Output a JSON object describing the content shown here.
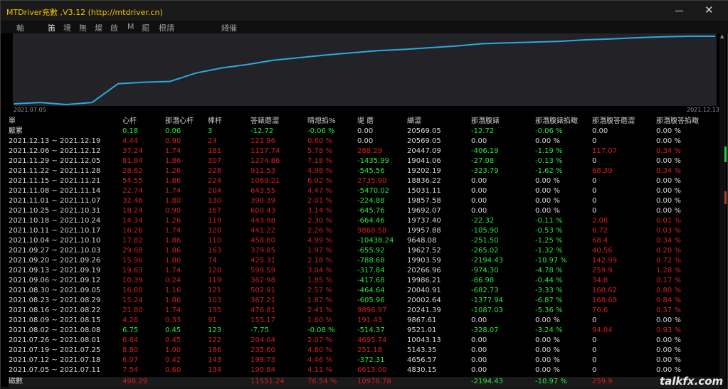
{
  "window": {
    "title": "MTDriver充數 ,V3.12 (http://mtdriver.cn)"
  },
  "tabs": [
    {
      "label": "軸"
    },
    {
      "label": "笛",
      "active": true
    },
    {
      "label": "境"
    },
    {
      "label": "無"
    },
    {
      "label": "燦"
    },
    {
      "label": "啟"
    },
    {
      "label": "M"
    },
    {
      "label": "掘"
    },
    {
      "label": "根請"
    },
    {
      "label": "綫催"
    }
  ],
  "chart_data": {
    "type": "line",
    "x_start_label": "2021.07.05",
    "x_end_label": "2021.12.13",
    "series": [
      {
        "color": "#29a9e1",
        "values": [
          4830.15,
          5143.35,
          4656.57,
          5143.35,
          9521.01,
          9867.61,
          10043.13,
          12000,
          13200,
          14000,
          15000,
          15600,
          16200,
          16700,
          17200,
          17500,
          17900,
          18300,
          18836.22,
          19032,
          19202.19,
          19400,
          19737.4,
          19957.88,
          20241.39,
          20447.09,
          20569.05,
          20569.05
        ]
      }
    ],
    "grid": false
  },
  "table": {
    "headers": [
      "單",
      "心杆",
      "那潛心杆",
      "棒杆",
      "答錶蘑澀",
      "晴熄掐%",
      "堤 蘑",
      "纈澀",
      "那潛腹錶",
      "那潛腹錶掐瞰",
      "那潛腹答蘑澀",
      "那潛腹答掐瞰"
    ],
    "rows": [
      {
        "label": "厭累",
        "cells": [
          "0.18",
          "0.06",
          "3",
          "-12.72",
          "-0.06 %",
          "0.00",
          "20569.05",
          "-12.72",
          "-0.06 %",
          "0.00",
          "0.00 %"
        ],
        "colors": [
          "green",
          "green",
          "green",
          "green",
          "green",
          "white",
          "white",
          "green",
          "green",
          "white",
          "white"
        ]
      },
      {
        "label": "2021.12.13 ~ 2021.12.19",
        "cells": [
          "4.44",
          "0.90",
          "24",
          "121.96",
          "0.60 %",
          "0.00",
          "20569.05",
          "0.00",
          "0.00 %",
          "0",
          "0.00 %"
        ],
        "colors": [
          "red",
          "red",
          "red",
          "red",
          "red",
          "white",
          "white",
          "white",
          "white",
          "white",
          "white"
        ]
      },
      {
        "label": "2021.12.06 ~ 2021.12.12",
        "cells": [
          "37.24",
          "1.74",
          "181",
          "1117.74",
          "5.78 %",
          "288.29",
          "20447.09",
          "-406.19",
          "-1.19 %",
          "117.07",
          "0.34 %"
        ],
        "colors": [
          "red",
          "red",
          "red",
          "red",
          "red",
          "red",
          "white",
          "green",
          "green",
          "red",
          "red"
        ]
      },
      {
        "label": "2021.11.29 ~ 2021.12.05",
        "cells": [
          "81.84",
          "1.86",
          "307",
          "1274.86",
          "7.18 %",
          "-1435.99",
          "19041.06",
          "-27.08",
          "-0.13 %",
          "0",
          "0.00 %"
        ],
        "colors": [
          "red",
          "red",
          "red",
          "red",
          "red",
          "green",
          "white",
          "green",
          "green",
          "white",
          "white"
        ]
      },
      {
        "label": "2021.11.22 ~ 2021.11.28",
        "cells": [
          "28.62",
          "1.26",
          "228",
          "911.53",
          "4.98 %",
          "-545.56",
          "19202.19",
          "-323.79",
          "-1.62 %",
          "68.39",
          "0.34 %"
        ],
        "colors": [
          "red",
          "red",
          "red",
          "red",
          "red",
          "green",
          "white",
          "green",
          "green",
          "red",
          "red"
        ]
      },
      {
        "label": "2021.11.15 ~ 2021.11.21",
        "cells": [
          "54.55",
          "1.86",
          "224",
          "1069.21",
          "6.02 %",
          "2735.90",
          "18836.22",
          "0.00",
          "0.00 %",
          "0",
          "0.00 %"
        ],
        "colors": [
          "red",
          "red",
          "red",
          "red",
          "red",
          "red",
          "white",
          "white",
          "white",
          "white",
          "white"
        ]
      },
      {
        "label": "2021.11.08 ~ 2021.11.14",
        "cells": [
          "22.74",
          "1.74",
          "204",
          "643.55",
          "4.47 %",
          "-5470.02",
          "15031.11",
          "0.00",
          "0.00 %",
          "0",
          "0.00 %"
        ],
        "colors": [
          "red",
          "red",
          "red",
          "red",
          "red",
          "green",
          "white",
          "white",
          "white",
          "white",
          "white"
        ]
      },
      {
        "label": "2021.11.01 ~ 2021.11.07",
        "cells": [
          "32.46",
          "1.80",
          "130",
          "390.39",
          "2.01 %",
          "-224.88",
          "19857.58",
          "0.00",
          "0.00 %",
          "0",
          "0.00 %"
        ],
        "colors": [
          "red",
          "red",
          "red",
          "red",
          "red",
          "green",
          "white",
          "white",
          "white",
          "white",
          "white"
        ]
      },
      {
        "label": "2021.10.25 ~ 2021.10.31",
        "cells": [
          "18.24",
          "0.90",
          "167",
          "600.43",
          "3.14 %",
          "-645.76",
          "19692.07",
          "0.00",
          "0.00 %",
          "0",
          "0.00 %"
        ],
        "colors": [
          "red",
          "red",
          "red",
          "red",
          "red",
          "green",
          "white",
          "white",
          "white",
          "white",
          "white"
        ]
      },
      {
        "label": "2021.10.18 ~ 2021.10.24",
        "cells": [
          "14.34",
          "1.26",
          "119",
          "443.98",
          "2.30 %",
          "-664.46",
          "19737.40",
          "-22.32",
          "-0.11 %",
          "2.08",
          "0.01 %"
        ],
        "colors": [
          "red",
          "red",
          "red",
          "red",
          "red",
          "green",
          "white",
          "green",
          "green",
          "red",
          "red"
        ]
      },
      {
        "label": "2021.10.11 ~ 2021.10.17",
        "cells": [
          "16.26",
          "1.74",
          "120",
          "441.22",
          "2.26 %",
          "9868.58",
          "19957.88",
          "-105.90",
          "-0.53 %",
          "6.72",
          "0.03 %"
        ],
        "colors": [
          "red",
          "red",
          "red",
          "red",
          "red",
          "red",
          "white",
          "green",
          "green",
          "red",
          "red"
        ]
      },
      {
        "label": "2021.10.04 ~ 2021.10.10",
        "cells": [
          "17.82",
          "1.86",
          "110",
          "458.80",
          "4.99 %",
          "-10438.24",
          "9648.08",
          "-251.50",
          "-1.25 %",
          "68.4",
          "0.34 %"
        ],
        "colors": [
          "red",
          "red",
          "red",
          "red",
          "red",
          "green",
          "white",
          "green",
          "green",
          "red",
          "red"
        ]
      },
      {
        "label": "2021.09.27 ~ 2021.10.03",
        "cells": [
          "29.68",
          "1.86",
          "163",
          "379.85",
          "1.97 %",
          "-655.92",
          "19627.52",
          "-265.02",
          "-1.32 %",
          "40.56",
          "0.20 %"
        ],
        "colors": [
          "red",
          "red",
          "red",
          "red",
          "red",
          "green",
          "white",
          "green",
          "green",
          "red",
          "red"
        ]
      },
      {
        "label": "2021.09.20 ~ 2021.09.26",
        "cells": [
          "15.96",
          "1.80",
          "74",
          "425.31",
          "2.18 %",
          "-788.68",
          "19903.59",
          "-2194.43",
          "-10.97 %",
          "142.99",
          "0.72 %"
        ],
        "colors": [
          "red",
          "red",
          "red",
          "red",
          "red",
          "green",
          "white",
          "green",
          "green",
          "red",
          "red"
        ]
      },
      {
        "label": "2021.09.13 ~ 2021.09.19",
        "cells": [
          "19.63",
          "1.74",
          "120",
          "598.59",
          "3.04 %",
          "-317.84",
          "20266.96",
          "-974.30",
          "-4.78 %",
          "259.9",
          "1.28 %"
        ],
        "colors": [
          "red",
          "red",
          "red",
          "red",
          "red",
          "green",
          "white",
          "green",
          "green",
          "red",
          "red"
        ]
      },
      {
        "label": "2021.09.06 ~ 2021.09.12",
        "cells": [
          "10.39",
          "0.24",
          "119",
          "362.98",
          "1.85 %",
          "-417.68",
          "19986.21",
          "-86.98",
          "-0.44 %",
          "34.8",
          "0.17 %"
        ],
        "colors": [
          "red",
          "red",
          "red",
          "red",
          "red",
          "green",
          "white",
          "green",
          "green",
          "red",
          "red"
        ]
      },
      {
        "label": "2021.08.30 ~ 2021.09.05",
        "cells": [
          "16.80",
          "1.16",
          "121",
          "502.91",
          "2.57 %",
          "-464.64",
          "20040.91",
          "-682.73",
          "-3.33 %",
          "160.62",
          "0.80 %"
        ],
        "colors": [
          "red",
          "red",
          "red",
          "red",
          "red",
          "green",
          "white",
          "green",
          "green",
          "red",
          "red"
        ]
      },
      {
        "label": "2021.08.23 ~ 2021.08.29",
        "cells": [
          "15.24",
          "1.86",
          "103",
          "367.21",
          "1.87 %",
          "-605.96",
          "20002.64",
          "-1377.94",
          "-6.87 %",
          "168.68",
          "0.84 %"
        ],
        "colors": [
          "red",
          "red",
          "red",
          "red",
          "red",
          "green",
          "white",
          "green",
          "green",
          "red",
          "red"
        ]
      },
      {
        "label": "2021.08.16 ~ 2021.08.22",
        "cells": [
          "21.80",
          "1.74",
          "135",
          "476.81",
          "2.41 %",
          "9896.97",
          "20241.39",
          "-1087.03",
          "-5.36 %",
          "76.6",
          "0.37 %"
        ],
        "colors": [
          "red",
          "red",
          "red",
          "red",
          "red",
          "red",
          "white",
          "green",
          "green",
          "red",
          "red"
        ]
      },
      {
        "label": "2021.08.09 ~ 2021.08.15",
        "cells": [
          "4.26",
          "0.33",
          "91",
          "155.17",
          "1.60 %",
          "191.43",
          "9867.61",
          "0.00",
          "0.00 %",
          "0",
          "0.00 %"
        ],
        "colors": [
          "red",
          "red",
          "red",
          "red",
          "red",
          "red",
          "white",
          "white",
          "white",
          "white",
          "white"
        ]
      },
      {
        "label": "2021.08.02 ~ 2021.08.08",
        "cells": [
          "6.75",
          "0.45",
          "123",
          "-7.75",
          "-0.08 %",
          "-514.37",
          "9521.01",
          "-328.07",
          "-3.24 %",
          "94.04",
          "0.93 %"
        ],
        "colors": [
          "green",
          "green",
          "green",
          "green",
          "green",
          "green",
          "white",
          "green",
          "green",
          "red",
          "red"
        ]
      },
      {
        "label": "2021.07.26 ~ 2021.08.01",
        "cells": [
          "6.64",
          "0.45",
          "122",
          "204.04",
          "2.07 %",
          "4695.74",
          "10043.13",
          "0.00",
          "0.00 %",
          "0",
          "0.00 %"
        ],
        "colors": [
          "red",
          "red",
          "red",
          "red",
          "red",
          "red",
          "white",
          "white",
          "white",
          "white",
          "white"
        ]
      },
      {
        "label": "2021.07.19 ~ 2021.07.25",
        "cells": [
          "8.80",
          "1.00",
          "186",
          "235.60",
          "4.80 %",
          "251.18",
          "5143.35",
          "0.00",
          "0.00 %",
          "0",
          "0.00 %"
        ],
        "colors": [
          "red",
          "red",
          "red",
          "red",
          "red",
          "red",
          "white",
          "white",
          "white",
          "white",
          "white"
        ]
      },
      {
        "label": "2021.07.12 ~ 2021.07.18",
        "cells": [
          "6.07",
          "0.42",
          "143",
          "198.73",
          "4.46 %",
          "-372.31",
          "4656.57",
          "0.00",
          "0.00 %",
          "0",
          "0.00 %"
        ],
        "colors": [
          "red",
          "red",
          "red",
          "red",
          "red",
          "green",
          "white",
          "white",
          "white",
          "white",
          "white"
        ]
      },
      {
        "label": "2021.07.05 ~ 2021.07.11",
        "cells": [
          "7.54",
          "0.60",
          "134",
          "190.84",
          "4.11 %",
          "6613.00",
          "4830.15",
          "0.00",
          "0.00 %",
          "0",
          "0.00 %"
        ],
        "colors": [
          "red",
          "red",
          "red",
          "red",
          "red",
          "red",
          "white",
          "white",
          "white",
          "white",
          "white"
        ]
      }
    ],
    "summary": {
      "label": "磁數",
      "cells": [
        "498.29",
        "",
        "",
        "11551.24",
        "76.54 %",
        "10978.78",
        "",
        "-2194.43",
        "-10.97 %",
        "259.9",
        ""
      ],
      "colors": [
        "red",
        "white",
        "white",
        "red",
        "red",
        "red",
        "white",
        "green",
        "green",
        "red",
        "white"
      ]
    }
  },
  "watermark": "talkfx.com",
  "colors": {
    "red": "#d81e1e",
    "green": "#27e83a",
    "line": "#29a9e1",
    "title": "#f2c200"
  }
}
